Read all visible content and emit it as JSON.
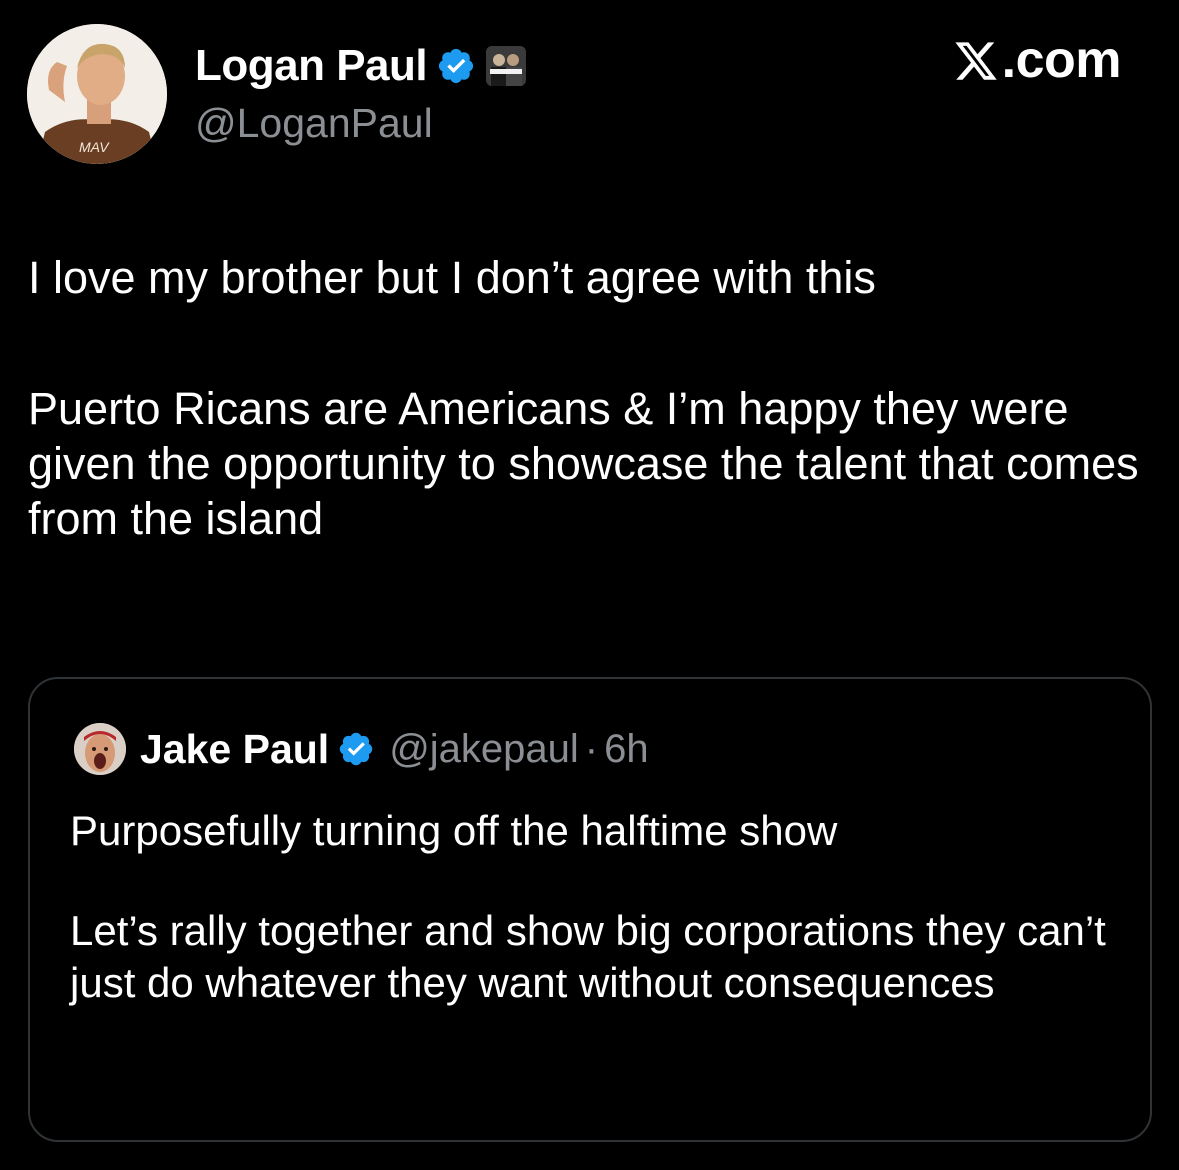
{
  "author": {
    "name": "Logan Paul",
    "handle": "@LoganPaul",
    "verified_icon": "verified-badge-icon",
    "affiliate_badge_icon": "affiliate-badge-icon",
    "avatar_shirt_text": "MAV"
  },
  "brand": {
    "label": ".com"
  },
  "tweet": {
    "paragraphs": [
      "I love my brother but I don’t agree with this",
      "Puerto Ricans are Americans & I’m happy they were given the opportunity to showcase the talent that comes from the island"
    ]
  },
  "quote": {
    "name": "Jake Paul",
    "handle": "@jakepaul",
    "separator": "·",
    "time": "6h",
    "paragraphs": [
      "Purposefully turning off the halftime show",
      "Let’s rally together and show big corporations they can’t just do whatever they want without consequences"
    ]
  },
  "colors": {
    "background": "#000000",
    "text": "#ffffff",
    "secondary_text": "#8b8f94",
    "verified_blue": "#1d9bf0",
    "card_border": "#2f3336"
  }
}
